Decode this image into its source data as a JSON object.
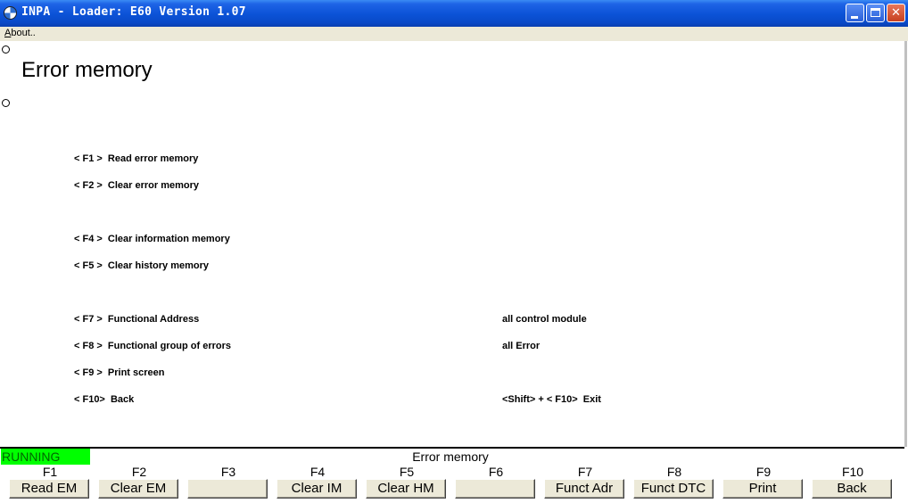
{
  "window": {
    "title": "INPA - Loader:  E60 Version 1.07"
  },
  "menu": {
    "about": "About.."
  },
  "page": {
    "title": "Error memory"
  },
  "commands": [
    {
      "label": "< F1 >  Read error memory"
    },
    {
      "label": "< F2 >  Clear error memory"
    },
    {
      "label": "< F4 >  Clear information memory"
    },
    {
      "label": "< F5 >  Clear history memory"
    },
    {
      "label": "< F7 >  Functional Address"
    },
    {
      "label": "< F8 >  Functional group of errors"
    },
    {
      "label": "< F9 >  Print screen"
    },
    {
      "label": "< F10>  Back"
    }
  ],
  "values": {
    "functional_address": "all control module",
    "functional_group": "all Error",
    "exit": "<Shift> + < F10>  Exit"
  },
  "status": {
    "state": "RUNNING",
    "title": "Error memory"
  },
  "fkeys": [
    {
      "key": "F1",
      "label": "Read EM"
    },
    {
      "key": "F2",
      "label": "Clear EM"
    },
    {
      "key": "F3",
      "label": ""
    },
    {
      "key": "F4",
      "label": "Clear IM"
    },
    {
      "key": "F5",
      "label": "Clear HM"
    },
    {
      "key": "F6",
      "label": ""
    },
    {
      "key": "F7",
      "label": "Funct Adr"
    },
    {
      "key": "F8",
      "label": "Funct DTC"
    },
    {
      "key": "F9",
      "label": "Print"
    },
    {
      "key": "F10",
      "label": "Back"
    }
  ],
  "colors": {
    "running_bg": "#00ff00",
    "titlebar": "#0a52d6"
  }
}
